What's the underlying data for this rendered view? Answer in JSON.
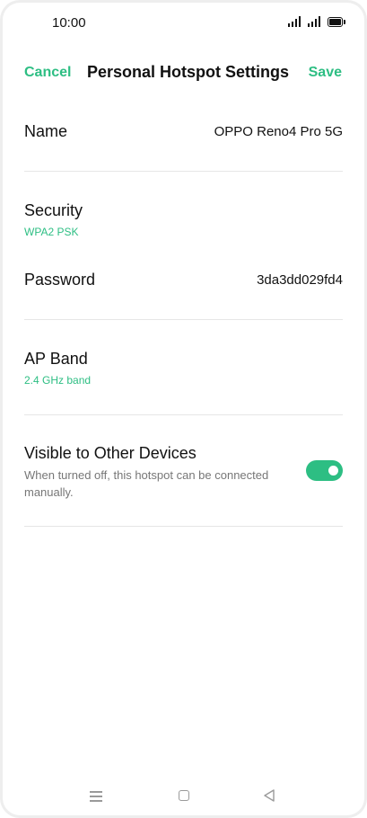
{
  "status_bar": {
    "time": "10:00"
  },
  "header": {
    "cancel_label": "Cancel",
    "title": "Personal Hotspot Settings",
    "save_label": "Save"
  },
  "settings": {
    "name": {
      "label": "Name",
      "value": "OPPO Reno4 Pro 5G"
    },
    "security": {
      "label": "Security",
      "value": "WPA2 PSK"
    },
    "password": {
      "label": "Password",
      "value": "3da3dd029fd4"
    },
    "ap_band": {
      "label": "AP Band",
      "value": "2.4 GHz band"
    },
    "visible": {
      "label": "Visible to Other Devices",
      "description": "When turned off, this hotspot can be connected manually.",
      "enabled": true
    }
  },
  "colors": {
    "accent": "#2DBE83",
    "text": "#111111",
    "secondary": "#777777",
    "divider": "#e6e6e6"
  },
  "icons": [
    "signal-icon",
    "battery-icon",
    "menu-icon",
    "home-icon",
    "back-icon"
  ]
}
